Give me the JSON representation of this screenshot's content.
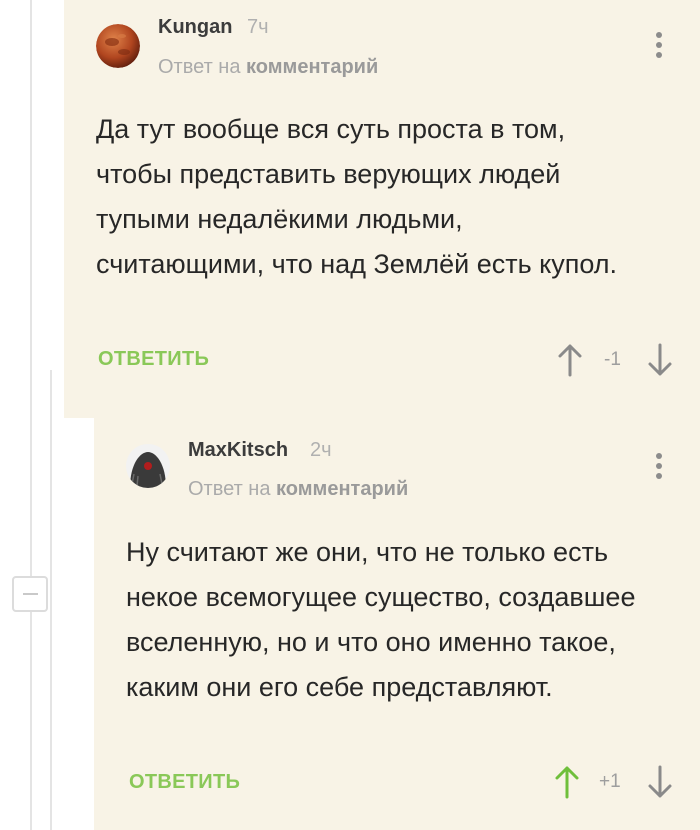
{
  "comments": [
    {
      "username": "Kungan",
      "time": "7ч",
      "reply_prefix": "Ответ на",
      "reply_target": "комментарий",
      "text": "Да тут вообще вся суть проста в том, чтобы представить верующих людей тупыми недалёкими людьми, считающими, что над Землёй есть купол.",
      "reply_label": "ОТВЕТИТЬ",
      "score": "-1",
      "avatar_icon": "planet-avatar"
    },
    {
      "username": "MaxKitsch",
      "time": "2ч",
      "reply_prefix": "Ответ на",
      "reply_target": "комментарий",
      "text": "Ну считают же они, что не только есть некое всемогущее существо, создавшее вселенную, но и что оно именно такое, каким они его себе представляют.",
      "reply_label": "ОТВЕТИТЬ",
      "score": "+1",
      "upvoted": true,
      "avatar_icon": "dark-figure-avatar"
    }
  ],
  "colors": {
    "comment_bg": "#f8f3e6",
    "reply_green": "#8ac858",
    "upvote_active": "#6fbf3b",
    "arrow_inactive": "#8a8a8a"
  },
  "icons": [
    "collapse-icon",
    "menu-dots-icon",
    "upvote-arrow-icon",
    "downvote-arrow-icon"
  ]
}
